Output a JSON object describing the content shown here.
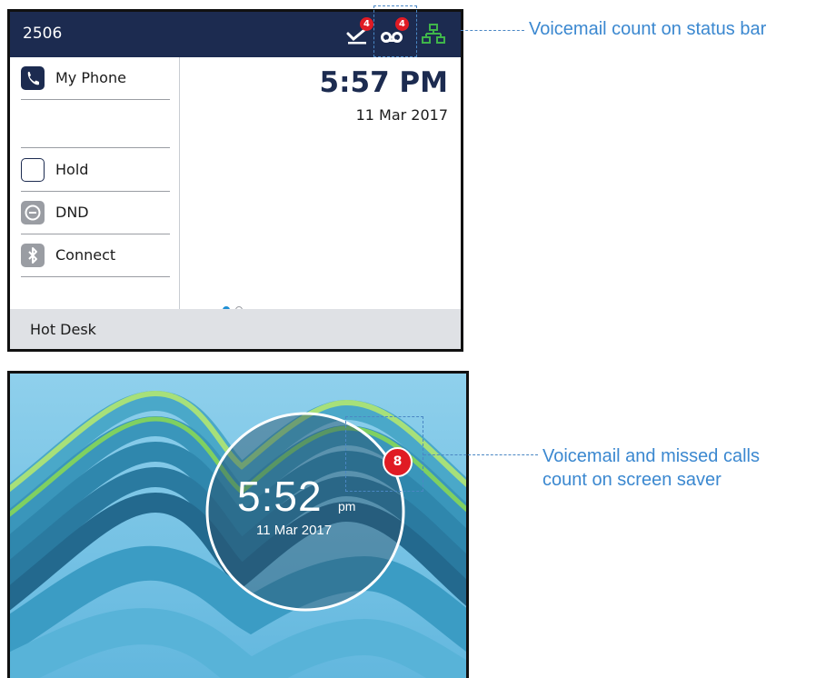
{
  "phone_screen": {
    "extension": "2506",
    "status_icons": [
      {
        "name": "missed-calls-icon",
        "badge": "4"
      },
      {
        "name": "voicemail-icon",
        "badge": "4"
      },
      {
        "name": "network-icon"
      }
    ],
    "keys": [
      {
        "label": "My Phone",
        "icon": "phone-icon"
      },
      {
        "label": "Hold",
        "icon": "hold-icon"
      },
      {
        "label": "DND",
        "icon": "dnd-icon"
      },
      {
        "label": "Connect",
        "icon": "bluetooth-icon"
      }
    ],
    "time": "5:57 PM",
    "date": "11 Mar 2017",
    "page_indicator": {
      "current": 1,
      "total": 2
    },
    "softkey": "Hot Desk"
  },
  "screen_saver": {
    "time": "5:52",
    "ampm": "pm",
    "date": "11 Mar 2017",
    "badge": "8"
  },
  "callouts": {
    "status_bar": "Voicemail count on status bar",
    "saver_line1": "Voicemail and missed calls",
    "saver_line2": "count on screen saver"
  },
  "colors": {
    "status_bar": "#1c2b50",
    "badge_red": "#e01b24",
    "callout_blue": "#3b88d0",
    "network_green": "#3fb54a",
    "page_dot_active": "#1e8fd4"
  }
}
